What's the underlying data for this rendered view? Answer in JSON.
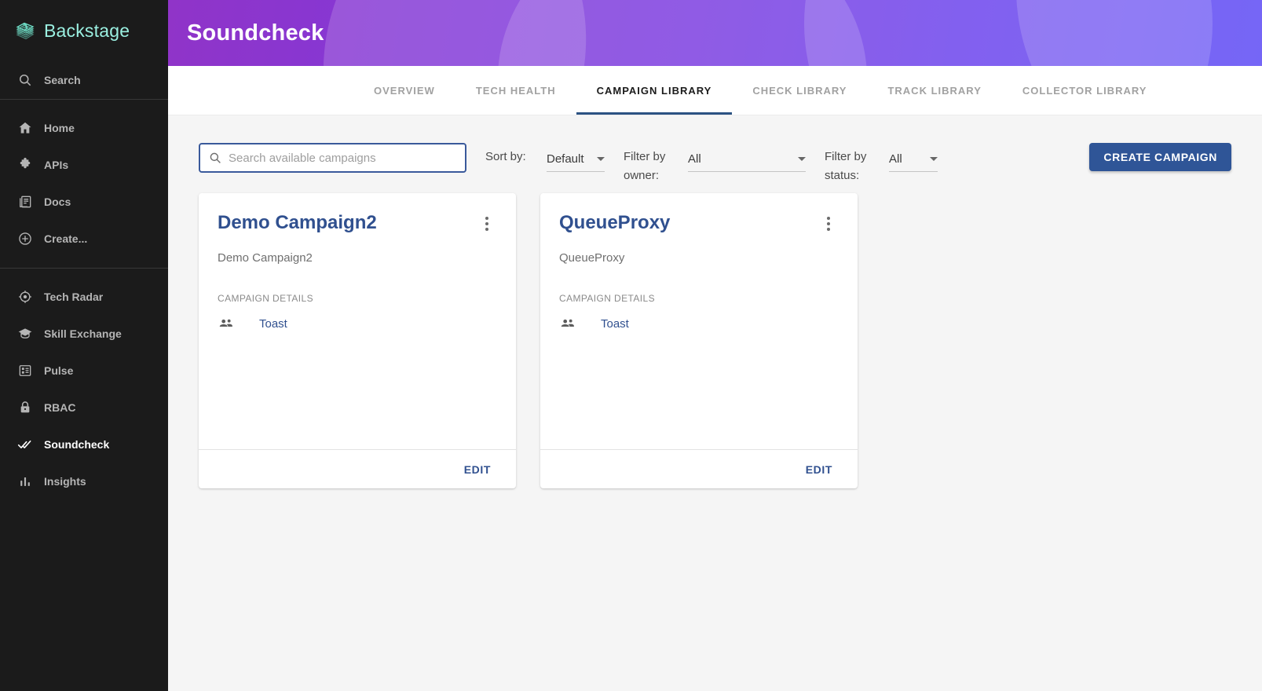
{
  "sidebar": {
    "brand": {
      "name": "Backstage",
      "logo_icon": "backstage-stack-logo"
    },
    "search": {
      "label": "Search",
      "icon": "search-icon"
    },
    "items": [
      {
        "label": "Home",
        "icon": "home-icon",
        "active": false
      },
      {
        "label": "APIs",
        "icon": "puzzle-piece-icon",
        "active": false
      },
      {
        "label": "Docs",
        "icon": "docs-book-icon",
        "active": false
      },
      {
        "label": "Create...",
        "icon": "plus-circle-icon",
        "active": false
      }
    ],
    "items2": [
      {
        "label": "Tech Radar",
        "icon": "radar-target-icon",
        "active": false
      },
      {
        "label": "Skill Exchange",
        "icon": "graduation-cap-icon",
        "active": false
      },
      {
        "label": "Pulse",
        "icon": "dashboard-grid-icon",
        "active": false
      },
      {
        "label": "RBAC",
        "icon": "lock-icon",
        "active": false
      },
      {
        "label": "Soundcheck",
        "icon": "double-check-icon",
        "active": true
      },
      {
        "label": "Insights",
        "icon": "bar-chart-icon",
        "active": false
      }
    ]
  },
  "header": {
    "title": "Soundcheck",
    "gradient_from": "#9034c8",
    "gradient_to": "#5b49f5"
  },
  "tabs": [
    {
      "label": "OVERVIEW",
      "active": false
    },
    {
      "label": "TECH HEALTH",
      "active": false
    },
    {
      "label": "CAMPAIGN LIBRARY",
      "active": true
    },
    {
      "label": "CHECK LIBRARY",
      "active": false
    },
    {
      "label": "TRACK LIBRARY",
      "active": false
    },
    {
      "label": "COLLECTOR LIBRARY",
      "active": false
    }
  ],
  "toolbar": {
    "search": {
      "placeholder": "Search available campaigns",
      "value": "",
      "icon": "search-icon",
      "focused": true,
      "focus_border_color": "#3a5a9b"
    },
    "sort": {
      "label": "Sort by:",
      "value": "Default"
    },
    "filter_owner": {
      "label": "Filter by owner:",
      "value": "All"
    },
    "filter_status": {
      "label": "Filter by status:",
      "value": "All"
    },
    "create_button": {
      "label": "CREATE CAMPAIGN",
      "color": "#2f5597"
    }
  },
  "cards": [
    {
      "title": "Demo Campaign2",
      "description": "Demo Campaign2",
      "details_label": "CAMPAIGN DETAILS",
      "owner": "Toast",
      "owner_icon": "people-group-icon",
      "menu_icon": "kebab-menu-icon",
      "edit_label": "EDIT"
    },
    {
      "title": "QueueProxy",
      "description": "QueueProxy",
      "details_label": "CAMPAIGN DETAILS",
      "owner": "Toast",
      "owner_icon": "people-group-icon",
      "menu_icon": "kebab-menu-icon",
      "edit_label": "EDIT"
    }
  ],
  "colors": {
    "sidebar_bg": "#1b1b1b",
    "brand_teal": "#9bf0e1",
    "page_bg": "#f5f5f5",
    "card_bg": "#ffffff",
    "accent_blue": "#30508f",
    "tab_active_underline": "#2c5282"
  }
}
